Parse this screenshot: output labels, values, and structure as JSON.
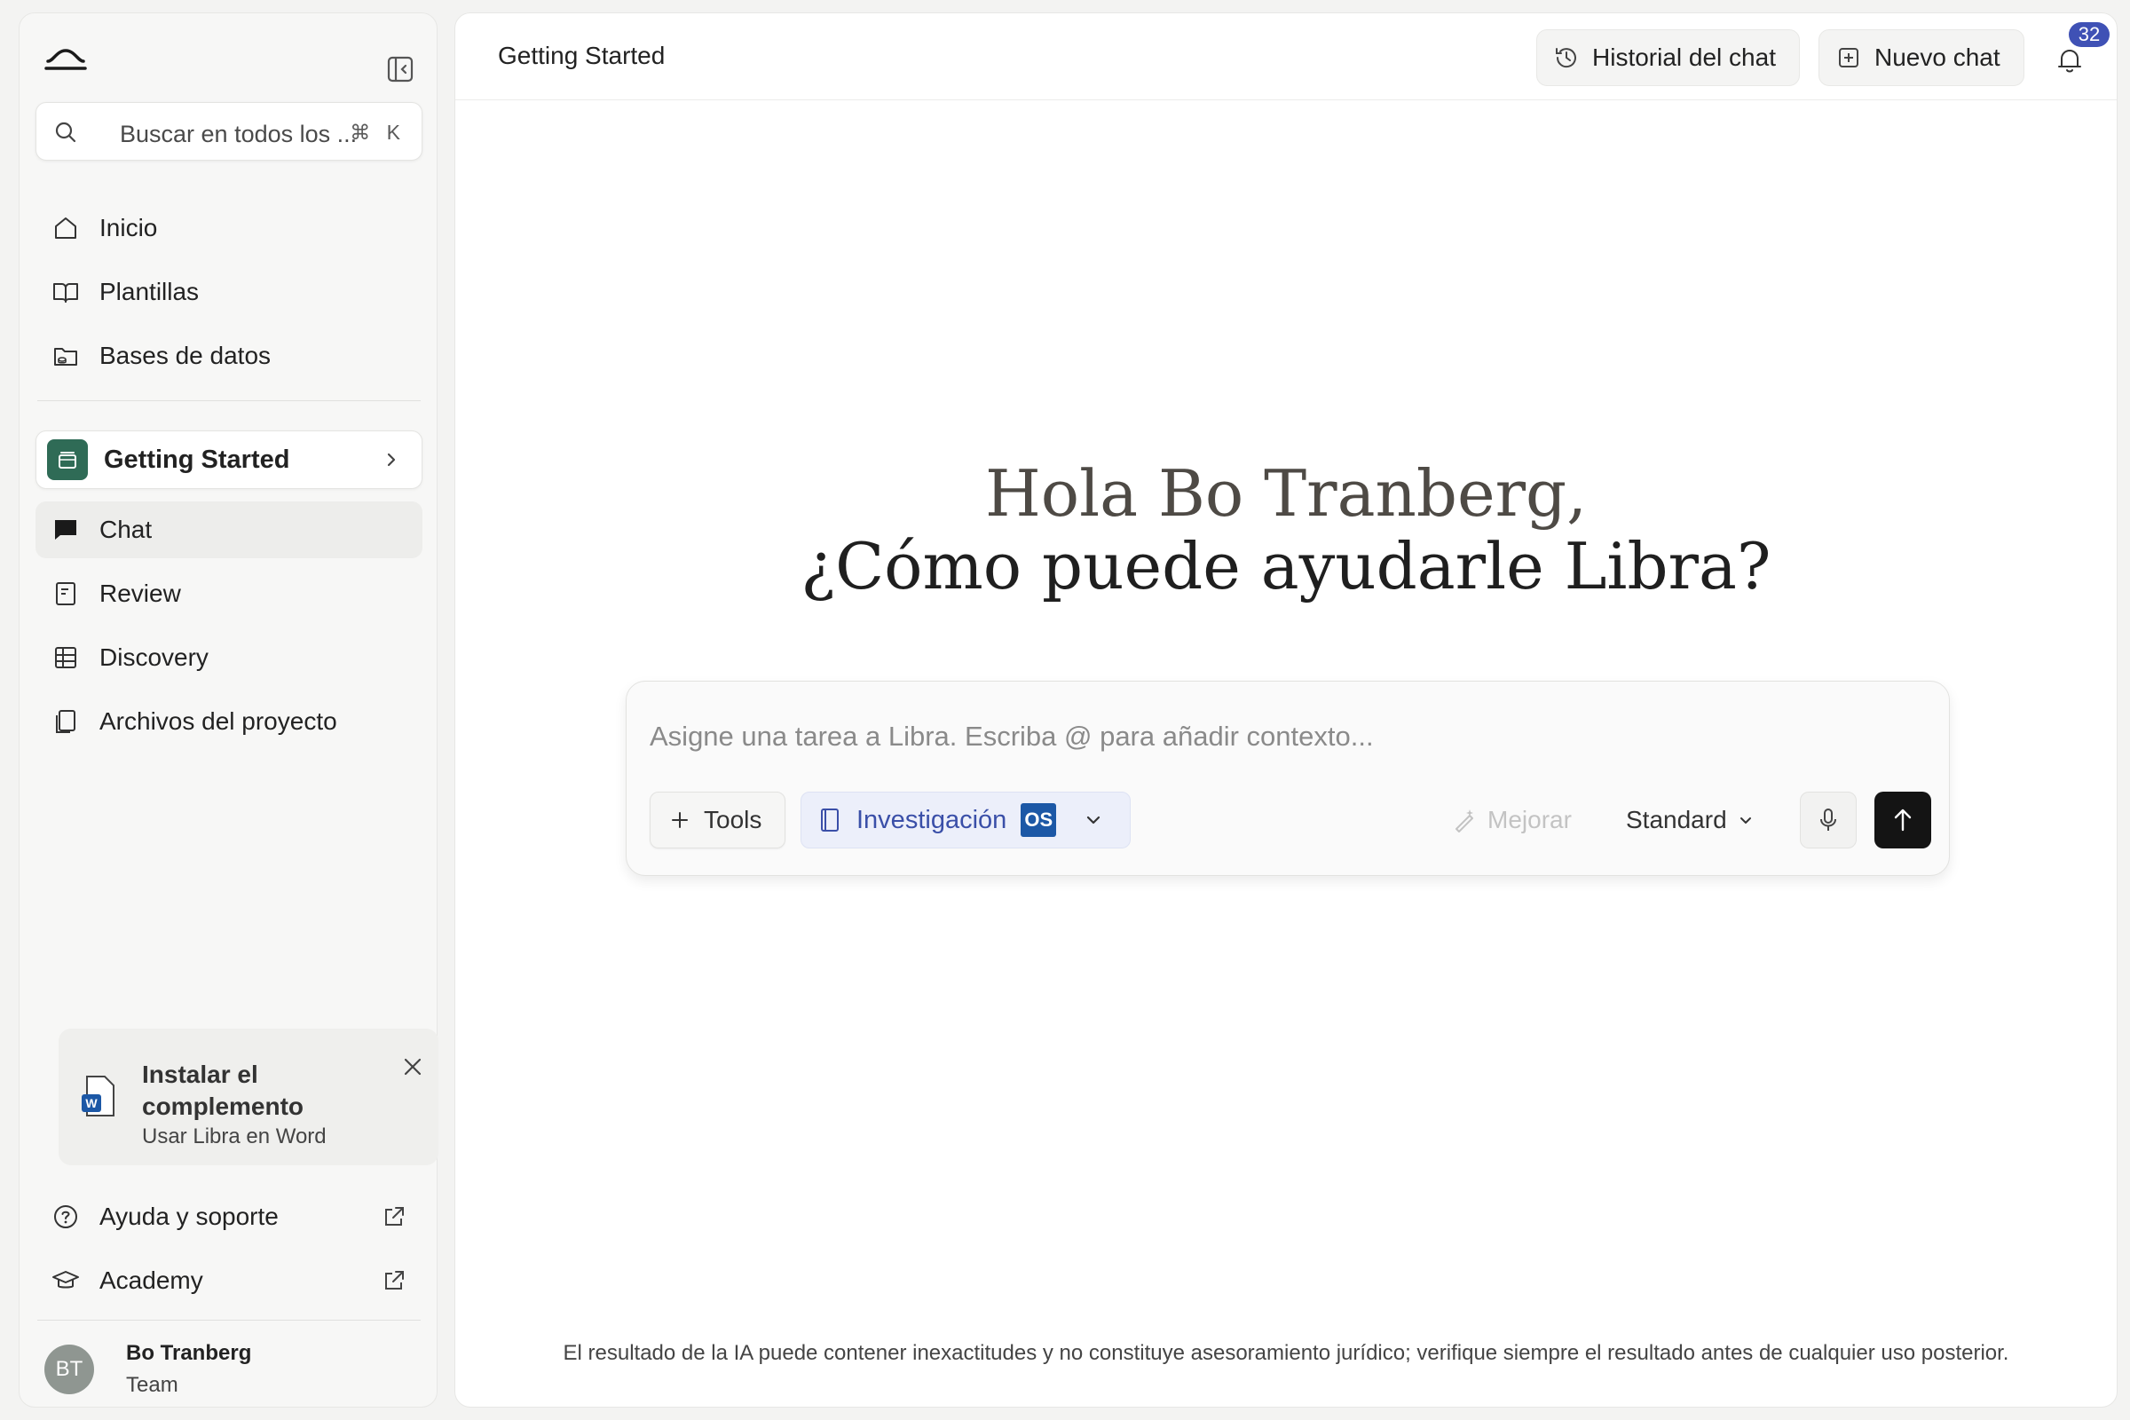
{
  "sidebar": {
    "search": {
      "placeholder": "Buscar en todos los ...",
      "shortcut": "⌘ K"
    },
    "nav": [
      {
        "label": "Inicio",
        "icon": "home-icon"
      },
      {
        "label": "Plantillas",
        "icon": "book-icon"
      },
      {
        "label": "Bases de datos",
        "icon": "database-folder-icon"
      }
    ],
    "project": {
      "label": "Getting Started",
      "icon": "project-box-icon",
      "color": "#2f6b56"
    },
    "project_nav": [
      {
        "label": "Chat",
        "icon": "chat-bubble-icon",
        "active": true
      },
      {
        "label": "Review",
        "icon": "review-document-icon",
        "active": false
      },
      {
        "label": "Discovery",
        "icon": "table-grid-icon",
        "active": false
      },
      {
        "label": "Archivos del proyecto",
        "icon": "files-icon",
        "active": false
      }
    ],
    "addin": {
      "title": "Instalar el complemento",
      "subtitle": "Usar Libra en Word",
      "icon": "word-document-icon"
    },
    "footer_links": [
      {
        "label": "Ayuda y soporte",
        "icon": "help-circle-icon"
      },
      {
        "label": "Academy",
        "icon": "graduation-cap-icon"
      }
    ],
    "user": {
      "initials": "BT",
      "name": "Bo Tranberg",
      "role": "Team"
    }
  },
  "topbar": {
    "title": "Getting Started",
    "history_label": "Historial del chat",
    "new_chat_label": "Nuevo chat",
    "notifications_count": "32"
  },
  "greeting": {
    "line1": "Hola Bo Tranberg,",
    "line2": "¿Cómo puede ayudarle Libra?"
  },
  "composer": {
    "placeholder": "Asigne una tarea a Libra. Escriba @ para añadir contexto...",
    "tools_label": "Tools",
    "research_label": "Investigación",
    "research_badge": "OS",
    "improve_label": "Mejorar",
    "mode_label": "Standard"
  },
  "disclaimer": "El resultado de la IA puede contener inexactitudes y no constituye asesoramiento jurídico; verifique siempre el resultado antes de cualquier uso posterior.",
  "colors": {
    "accent": "#3f51b5",
    "project": "#2f6b56",
    "research_bg": "#eceffa",
    "research_text": "#3a4fa8"
  }
}
